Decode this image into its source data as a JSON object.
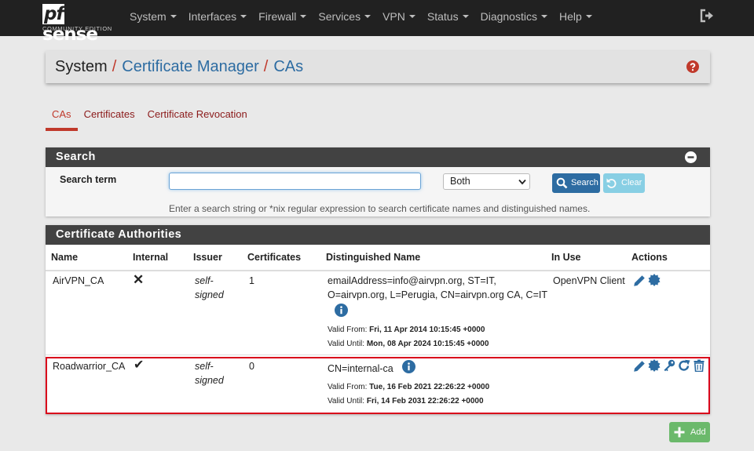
{
  "brand": {
    "name": "sense",
    "name_prefix": "pf",
    "edition": "COMMUNITY EDITION"
  },
  "nav": {
    "items": [
      "System",
      "Interfaces",
      "Firewall",
      "Services",
      "VPN",
      "Status",
      "Diagnostics",
      "Help"
    ]
  },
  "breadcrumb": {
    "root": "System",
    "sep": "/",
    "parent": "Certificate Manager",
    "current": "CAs"
  },
  "tabs": [
    "CAs",
    "Certificates",
    "Certificate Revocation"
  ],
  "search": {
    "heading": "Search",
    "label": "Search term",
    "value": "",
    "scope": "Both",
    "search_button": "Search",
    "clear_button": "Clear",
    "help": "Enter a search string or *nix regular expression to search certificate names and distinguished names."
  },
  "ca_table": {
    "heading": "Certificate Authorities",
    "columns": [
      "Name",
      "Internal",
      "Issuer",
      "Certificates",
      "Distinguished Name",
      "In Use",
      "Actions"
    ],
    "rows": [
      {
        "name": "AirVPN_CA",
        "internal": "✕",
        "issuer_line1": "self-",
        "issuer_line2": "signed",
        "certificates": "1",
        "dn_line1": "emailAddress=info@airvpn.org, ST=IT,",
        "dn_line2": "O=airvpn.org, L=Perugia, CN=airvpn.org CA, C=IT",
        "valid_from_label": "Valid From:",
        "valid_from": "Fri, 11 Apr 2014 10:15:45 +0000",
        "valid_until_label": "Valid Until:",
        "valid_until": "Mon, 08 Apr 2024 10:15:45 +0000",
        "in_use": "OpenVPN Client"
      },
      {
        "name": "Roadwarrior_CA",
        "internal": "✔",
        "issuer_line1": "self-",
        "issuer_line2": "signed",
        "certificates": "0",
        "dn_line1": "CN=internal-ca",
        "valid_from_label": "Valid From:",
        "valid_from": "Tue, 16 Feb 2021 22:26:22 +0000",
        "valid_until_label": "Valid Until:",
        "valid_until": "Fri, 14 Feb 2031 22:26:22 +0000",
        "in_use": ""
      }
    ]
  },
  "add_button": "Add",
  "colors": {
    "nav_bg": "#212121",
    "accent_red": "#c0392b",
    "link_blue": "#2d6ca2",
    "highlight": "#d9001b",
    "add_green": "#4cae4c"
  }
}
